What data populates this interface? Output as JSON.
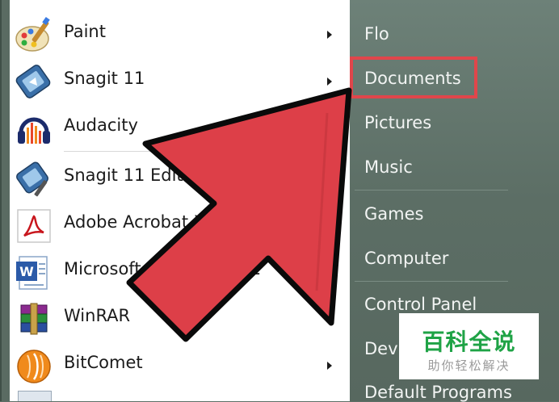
{
  "programs": [
    {
      "label": "Paint",
      "icon": "paint-icon",
      "submenu": true
    },
    {
      "label": "Snagit 11",
      "icon": "snagit-icon",
      "submenu": true
    },
    {
      "label": "Audacity",
      "icon": "audacity-icon",
      "submenu": false
    },
    {
      "label": "Snagit 11 Editor",
      "icon": "snagit-editor-icon",
      "submenu": false
    },
    {
      "label": "Adobe Acrobat X",
      "icon": "acrobat-icon",
      "submenu": false
    },
    {
      "label": "Microsoft Office Word 2",
      "icon": "word-icon",
      "submenu": false
    },
    {
      "label": "WinRAR",
      "icon": "winrar-icon",
      "submenu": true
    },
    {
      "label": "BitComet",
      "icon": "bitcomet-icon",
      "submenu": true
    }
  ],
  "places": [
    {
      "label": "Flo"
    },
    {
      "label": "Documents"
    },
    {
      "label": "Pictures"
    },
    {
      "label": "Music"
    },
    {
      "label": "Games"
    },
    {
      "label": "Computer"
    },
    {
      "label": "Control Panel"
    },
    {
      "label": "Devi"
    },
    {
      "label": "Default Programs"
    }
  ],
  "watermark": {
    "title": "百科全说",
    "subtitle": "助你轻松解决"
  },
  "colors": {
    "highlight": "#e0464b",
    "pointer_arrow": "#dd3f48",
    "watermark_green": "#1fa346"
  }
}
